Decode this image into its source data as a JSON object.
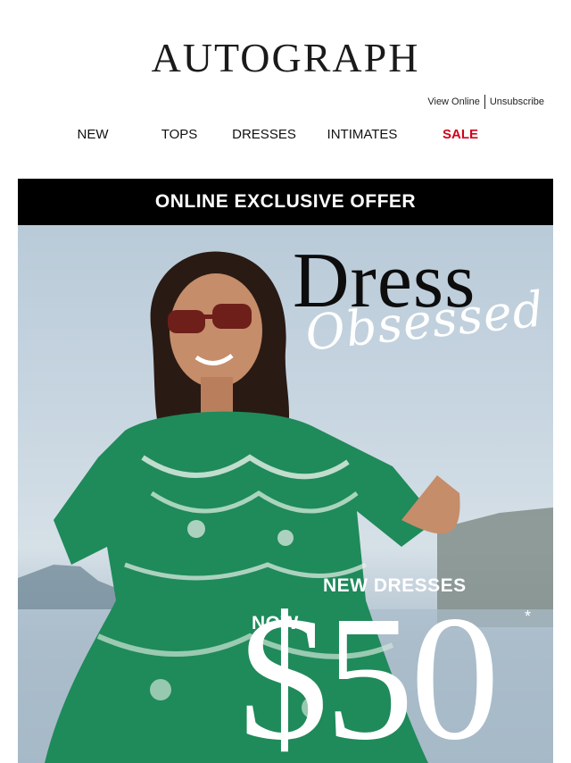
{
  "header": {
    "logo_text": "AUTOGRAPH",
    "view_online": "View Online",
    "unsubscribe": "Unsubscribe"
  },
  "nav": {
    "items": [
      {
        "label": "NEW"
      },
      {
        "label": "TOPS"
      },
      {
        "label": "DRESSES"
      },
      {
        "label": "INTIMATES"
      },
      {
        "label": "SALE",
        "color": "#d0021b"
      }
    ]
  },
  "banner": {
    "text": "ONLINE EXCLUSIVE OFFER"
  },
  "hero": {
    "title_main": "Dress",
    "title_script": "Obsessed",
    "subtitle": "NEW DRESSES",
    "now_label": "NOW",
    "price": "$50",
    "asterisk": "*"
  },
  "colors": {
    "banner_bg": "#000000",
    "sale_red": "#d0021b",
    "dress_green": "#1f8a5a"
  }
}
